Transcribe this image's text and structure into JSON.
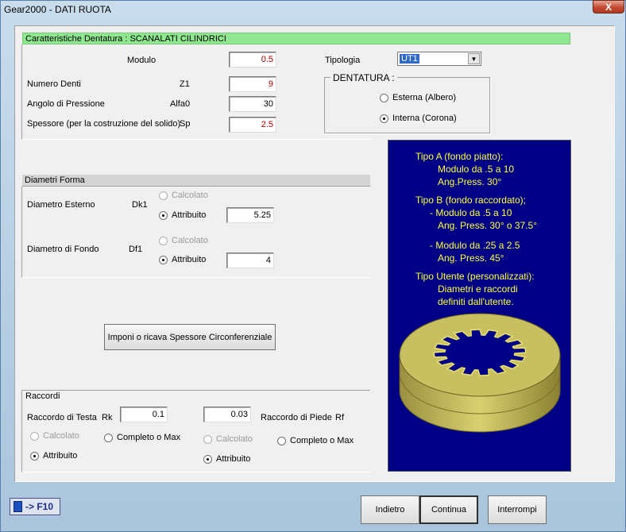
{
  "window": {
    "title": "Gear2000 - DATI RUOTA",
    "close_glyph": "X"
  },
  "dentatura": {
    "header": "Caratteristiche Dentatura : SCANALATI CILINDRICI",
    "modulo": {
      "label": "Modulo",
      "value": "0.5"
    },
    "numero_denti": {
      "label": "Numero Denti",
      "symbol": "Z1",
      "value": "9"
    },
    "angolo": {
      "label": "Angolo di Pressione",
      "symbol": "Alfa0",
      "value": "30"
    },
    "spessore": {
      "label": "Spessore (per la costruzione del solido)",
      "symbol": "Sp",
      "value": "2.5"
    },
    "tipologia": {
      "label": "Tipologia",
      "value": "UT1"
    },
    "group_title": "DENTATURA :",
    "esterna": "Esterna (Albero)",
    "interna": "Interna (Corona)"
  },
  "diametri": {
    "header": "Diametri Forma",
    "esterno": {
      "label": "Diametro Esterno",
      "symbol": "Dk1",
      "calc": "Calcolato",
      "attr": "Attribuito",
      "value": "5.25"
    },
    "fondo": {
      "label": "Diametro di Fondo",
      "symbol": "Df1",
      "calc": "Calcolato",
      "attr": "Attribuito",
      "value": "4"
    }
  },
  "spessore_button": "Imponi o ricava Spessore Circonferenziale",
  "raccordi": {
    "header": "Raccordi",
    "testa": {
      "label": "Raccordo di Testa",
      "symbol": "Rk",
      "value": "0.1",
      "calc": "Calcolato",
      "completo": "Completo o Max",
      "attr": "Attribuito"
    },
    "piede": {
      "label": "Raccordo di Piede",
      "symbol": "Rf",
      "value": "0.03",
      "calc": "Calcolato",
      "completo": "Completo o Max",
      "attr": "Attribuito"
    }
  },
  "info": {
    "lines": [
      "Tipo A (fondo piatto):",
      "Modulo da .5 a 10",
      "Ang.Press. 30°",
      "Tipo B (fondo raccordato);",
      "- Modulo da .5 a 10",
      "Ang. Press. 30° o 37.5°",
      "- Modulo da .25 a 2.5",
      "Ang. Press. 45°",
      "Tipo Utente (personalizzati):",
      "Diametri e raccordi",
      "definiti dall'utente."
    ]
  },
  "footer": {
    "f10": "-> F10",
    "indietro": "Indietro",
    "continua": "Continua",
    "interrompi": "Interrompi"
  },
  "colors": {
    "info_bg": "#000087",
    "info_text": "#ffff40",
    "header_green": "#8fe88f",
    "gear": "#c8c060"
  }
}
